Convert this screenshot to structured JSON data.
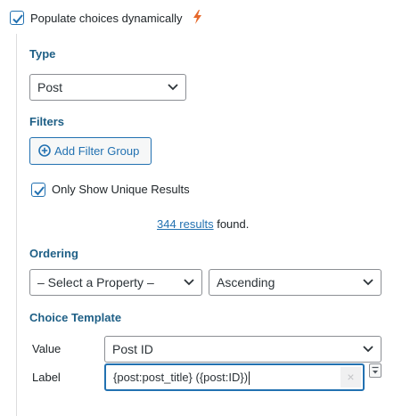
{
  "populate": {
    "label": "Populate choices dynamically",
    "checked": true
  },
  "type": {
    "title": "Type",
    "selected": "Post"
  },
  "filters": {
    "title": "Filters",
    "add_button": "Add Filter Group"
  },
  "unique": {
    "label": "Only Show Unique Results",
    "checked": true
  },
  "results": {
    "link": "344 results",
    "suffix": " found."
  },
  "ordering": {
    "title": "Ordering",
    "property": "– Select a Property –",
    "direction": "Ascending"
  },
  "template": {
    "title": "Choice Template",
    "value_label": "Value",
    "value_selected": "Post ID",
    "label_label": "Label",
    "label_value": "{post:post_title} ({post:ID})",
    "clear_glyph": "×"
  },
  "colors": {
    "accent": "#2271b1",
    "section_title": "#1e5f86",
    "bolt": "#e6692c"
  }
}
